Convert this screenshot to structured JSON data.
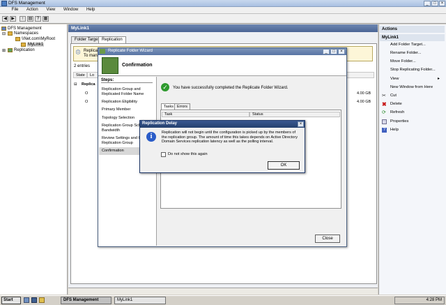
{
  "window": {
    "title": "DFS Management"
  },
  "menu": [
    "File",
    "Action",
    "View",
    "Window",
    "Help"
  ],
  "tree": {
    "root": "DFS Management",
    "namespaces": "Namespaces",
    "namespace_path": "\\\\Net.com\\MyRoot",
    "link": "MyLink1",
    "replication": "Replication"
  },
  "center": {
    "title": "MyLink1",
    "tabs": [
      "Folder Targets",
      "Replication"
    ],
    "info_line1": "Replicati",
    "info_line2": "To mana",
    "entries": "2 entries",
    "col1": "State",
    "col2": "Lo",
    "group_label": "Replica",
    "row1_prefix": "O",
    "row2_prefix": "O",
    "size1": "4.00 GB",
    "size2": "4.00 GB"
  },
  "actions": {
    "header": "Actions",
    "section": "MyLink1",
    "items": [
      "Add Folder Target...",
      "Rename Folder...",
      "Move Folder...",
      "Stop Replicating Folder...",
      "View",
      "New Window from Here",
      "Cut",
      "Delete",
      "Refresh",
      "Properties",
      "Help"
    ]
  },
  "wizard": {
    "title": "Replicate Folder Wizard",
    "heading": "Confirmation",
    "steps_header": "Steps:",
    "steps": [
      "Replication Group and Replicated Folder Name",
      "Replication Eligibility",
      "Primary Member",
      "Topology Selection",
      "Replication Group Sche and Bandwidth",
      "Review Settings and Cr Replication Group",
      "Confirmation"
    ],
    "success": "You have successfully completed the Replicate Folder Wizard.",
    "tabs": [
      "Tasks",
      "Errors"
    ],
    "task_col": "Task",
    "status_col": "Status",
    "close": "Close"
  },
  "dialog": {
    "title": "Replication Delay",
    "message": "Replication will not begin until the configuration is picked up by the members of the replication group. The amount of time this takes depends on Active Directory Domain Services replication latency as well as the polling interval.",
    "checkbox": "Do not show this again",
    "ok": "OK"
  },
  "taskbar": {
    "start": "Start",
    "tasks": [
      "DFS Management",
      "MyLink1"
    ],
    "time": "4:28 PM"
  }
}
